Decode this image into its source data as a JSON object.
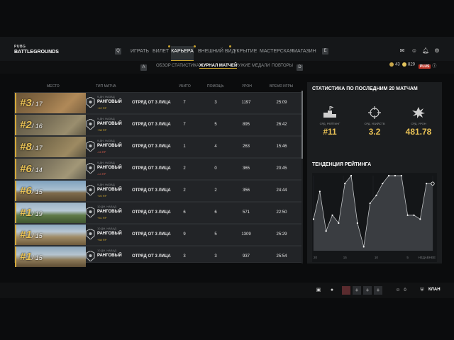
{
  "app": {
    "logo_top": "PUBG",
    "logo_bottom": "BATTLEGROUNDS"
  },
  "nav": {
    "left_key": "Q",
    "right_key": "E",
    "items": [
      {
        "label": "ИГРАТЬ",
        "active": false
      },
      {
        "label": "БИЛЕТ",
        "active": false,
        "dot": true
      },
      {
        "label": "КАРЬЕРА",
        "active": true,
        "dot": true
      },
      {
        "label": "ВНЕШНИЙ ВИД",
        "active": false,
        "dot": true
      },
      {
        "label": "УКРЫТИЕ",
        "active": false
      },
      {
        "label": "МАСТЕРСКАЯ",
        "active": false
      },
      {
        "label": "МАГАЗИН",
        "active": false
      }
    ]
  },
  "top_icons": {
    "notifications_count": "2"
  },
  "subnav": {
    "left_key": "A",
    "right_key": "D",
    "items": [
      {
        "label": "ОБЗОР",
        "active": false
      },
      {
        "label": "СТАТИСТИКА",
        "active": false
      },
      {
        "label": "ЖУРНАЛ МАТЧЕЙ",
        "active": true
      },
      {
        "label": "ОРУЖИЕ",
        "active": false,
        "dot": true
      },
      {
        "label": "МЕДАЛИ",
        "active": false,
        "dot": true
      },
      {
        "label": "ПОВТОРЫ",
        "active": false
      }
    ]
  },
  "currency": {
    "bp": "43",
    "coins": "829",
    "plus": "PLUS"
  },
  "table": {
    "headers": {
      "place": "МЕСТО",
      "type": "ТИП МАТЧА",
      "kills": "УБИТО",
      "assists": "ПОМОЩЬ",
      "damage": "УРОН",
      "time": "ВРЕМЯ ИГРЫ"
    },
    "rows": [
      {
        "place": "#3",
        "total": "/ 17",
        "ago": "9 ДН. НАЗАД",
        "mode": "РАНГОВЫЙ",
        "rp": "+42 RP",
        "rp_sign": "pos",
        "squad": "ОТРЯД ОТ 3 ЛИЦА",
        "kills": "7",
        "assists": "3",
        "damage": "1197",
        "time": "25:09",
        "map": "m1"
      },
      {
        "place": "#2",
        "total": "/ 16",
        "ago": "9 ДН. НАЗАД",
        "mode": "РАНГОВЫЙ",
        "rp": "+38 RP",
        "rp_sign": "pos",
        "squad": "ОТРЯД ОТ 3 ЛИЦА",
        "kills": "7",
        "assists": "5",
        "damage": "895",
        "time": "26:42",
        "map": "m2"
      },
      {
        "place": "#8",
        "total": "/ 17",
        "ago": "9 ДН. НАЗАД",
        "mode": "РАНГОВЫЙ",
        "rp": "-16 RP",
        "rp_sign": "neg",
        "squad": "ОТРЯД ОТ 3 ЛИЦА",
        "kills": "1",
        "assists": "4",
        "damage": "263",
        "time": "15:46",
        "map": "m3"
      },
      {
        "place": "#6",
        "total": "/ 14",
        "ago": "9 ДН. НАЗАД",
        "mode": "РАНГОВЫЙ",
        "rp": "-14 RP",
        "rp_sign": "neg",
        "squad": "ОТРЯД ОТ 3 ЛИЦА",
        "kills": "2",
        "assists": "0",
        "damage": "365",
        "time": "20:45",
        "map": "m4"
      },
      {
        "place": "#6",
        "total": "/ 15",
        "ago": "9 ДН. НАЗАД",
        "mode": "РАНГОВЫЙ",
        "rp": "+20 RP",
        "rp_sign": "pos",
        "squad": "ОТРЯД ОТ 3 ЛИЦА",
        "kills": "2",
        "assists": "2",
        "damage": "356",
        "time": "24:44",
        "map": "m5"
      },
      {
        "place": "#1",
        "total": "/ 19",
        "ago": "10 ДН. НАЗАД",
        "mode": "РАНГОВЫЙ",
        "rp": "+51 RP",
        "rp_sign": "pos",
        "squad": "ОТРЯД ОТ 3 ЛИЦА",
        "kills": "6",
        "assists": "6",
        "damage": "571",
        "time": "22:50",
        "map": "m6"
      },
      {
        "place": "#1",
        "total": "/ 15",
        "ago": "10 ДН. НАЗАД",
        "mode": "РАНГОВЫЙ",
        "rp": "+58 RP",
        "rp_sign": "pos",
        "squad": "ОТРЯД ОТ 3 ЛИЦА",
        "kills": "9",
        "assists": "5",
        "damage": "1309",
        "time": "25:29",
        "map": "m7"
      },
      {
        "place": "#1",
        "total": "/ 15",
        "ago": "10 ДН. НАЗАД",
        "mode": "РАНГОВЫЙ",
        "rp": "",
        "rp_sign": "pos",
        "squad": "ОТРЯД ОТ 3 ЛИЦА",
        "kills": "3",
        "assists": "3",
        "damage": "937",
        "time": "25:54",
        "map": "m8"
      }
    ]
  },
  "stats": {
    "title": "СТАТИСТИКА ПО ПОСЛЕДНИМ 20 МАТЧАМ",
    "avg_rank_label": "СРД. РЕЙТИНГ",
    "avg_rank_value": "#11",
    "avg_kills_label": "СРД. УБИЙСТВ",
    "avg_kills_value": "3.2",
    "avg_damage_label": "СРД. УРОН",
    "avg_damage_value": "481.78",
    "trend_title": "ТЕНДЕНЦИЯ РЕЙТИНГА"
  },
  "chart_data": {
    "type": "area",
    "x_tick_labels": [
      "20",
      "15",
      "10",
      "5",
      "НЕДАВНЕЕ"
    ],
    "x": [
      20,
      19,
      18,
      17,
      16,
      15,
      14,
      13,
      12,
      11,
      10,
      9,
      8,
      7,
      6,
      5,
      4,
      3,
      2,
      1
    ],
    "values": [
      12,
      5,
      15,
      11,
      13,
      3,
      1,
      13,
      19,
      8,
      6,
      3,
      1,
      1,
      1,
      11,
      11,
      12,
      3,
      3
    ],
    "ylim": [
      20,
      1
    ],
    "grid": true,
    "colors": {
      "line": "#bfc2c4",
      "fill": "#3a3d41",
      "point": "#ffffff"
    }
  },
  "bottom": {
    "clan_label": "КЛАН",
    "friends_count": "0"
  }
}
